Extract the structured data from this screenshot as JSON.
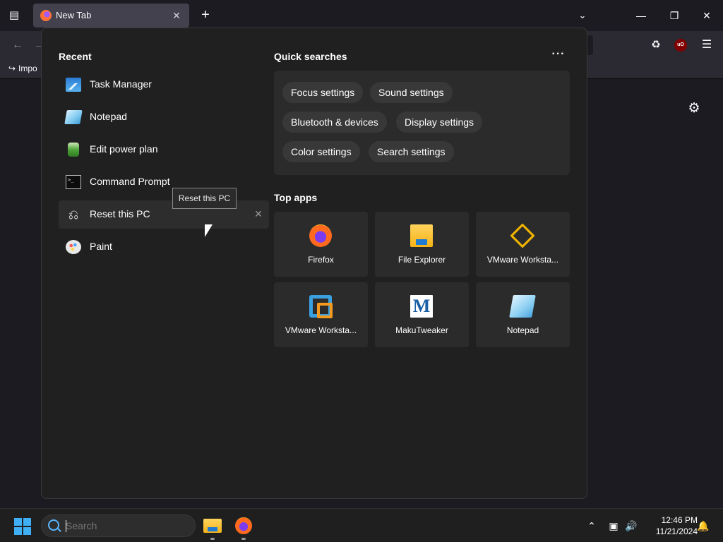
{
  "browser": {
    "tab": {
      "title": "New Tab"
    },
    "bookmarks": [
      {
        "label": "Impo"
      }
    ]
  },
  "flyout": {
    "recent": {
      "title": "Recent",
      "items": [
        {
          "label": "Task Manager",
          "icon": "task-manager-icon"
        },
        {
          "label": "Notepad",
          "icon": "notepad-icon"
        },
        {
          "label": "Edit power plan",
          "icon": "power-plan-icon"
        },
        {
          "label": "Command Prompt",
          "icon": "command-prompt-icon"
        },
        {
          "label": "Reset this PC",
          "icon": "reset-pc-icon",
          "hovered": true
        },
        {
          "label": "Paint",
          "icon": "paint-icon"
        }
      ],
      "tooltip": "Reset this PC"
    },
    "quick_searches": {
      "title": "Quick searches",
      "pills": [
        {
          "label": "Focus settings"
        },
        {
          "label": "Sound settings"
        },
        {
          "label": "Bluetooth & devices"
        },
        {
          "label": "Display settings"
        },
        {
          "label": "Color settings"
        },
        {
          "label": "Search settings"
        }
      ]
    },
    "top_apps": {
      "title": "Top apps",
      "apps": [
        {
          "label": "Firefox",
          "icon": "firefox-icon"
        },
        {
          "label": "File Explorer",
          "icon": "file-explorer-icon"
        },
        {
          "label": "VMware Worksta...",
          "icon": "vmware-icon"
        },
        {
          "label": "VMware Worksta...",
          "icon": "vmware-player-icon"
        },
        {
          "label": "MakuTweaker",
          "icon": "makutweaker-icon"
        },
        {
          "label": "Notepad",
          "icon": "notepad-icon"
        }
      ]
    }
  },
  "taskbar": {
    "search_placeholder": "Search",
    "clock": {
      "time": "12:46 PM",
      "date": "11/21/2024"
    }
  },
  "colors": {
    "flyout_bg": "#202020",
    "tile_bg": "#2b2b2b",
    "accent": "#3fb0f5"
  }
}
